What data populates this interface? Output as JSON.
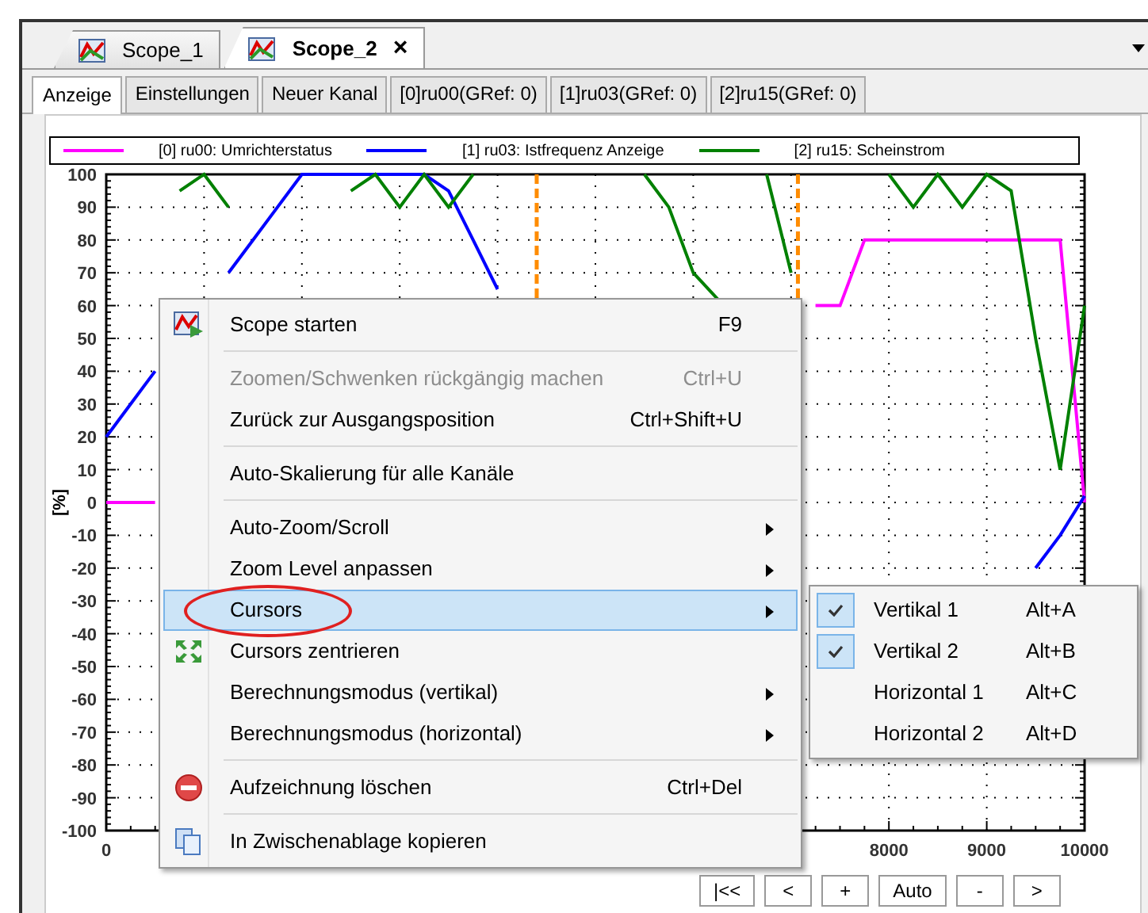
{
  "document_tabs": [
    {
      "label": "Scope_1",
      "selected": false,
      "closable": false
    },
    {
      "label": "Scope_2",
      "selected": true,
      "closable": true,
      "close": "×"
    }
  ],
  "view_tabs": [
    {
      "label": "Anzeige",
      "selected": true
    },
    {
      "label": "Einstellungen",
      "selected": false
    },
    {
      "label": "Neuer Kanal",
      "selected": false
    },
    {
      "label": "[0]ru00(GRef: 0)",
      "selected": false
    },
    {
      "label": "[1]ru03(GRef: 0)",
      "selected": false
    },
    {
      "label": "[2]ru15(GRef: 0)",
      "selected": false
    }
  ],
  "scope": {
    "chart_data": {
      "type": "line",
      "ylabel": "[%]",
      "x": [
        0,
        250,
        500,
        750,
        1000,
        1250,
        1500,
        1750,
        2000,
        2250,
        2500,
        2750,
        3000,
        3250,
        3500,
        3750,
        4000,
        4250,
        4500,
        4750,
        5000,
        5250,
        5500,
        5750,
        6000,
        6250,
        6500,
        6750,
        7000,
        7250,
        7500,
        7750,
        8000,
        8250,
        8500,
        8750,
        9000,
        9250,
        9500,
        9750,
        10000
      ],
      "xlim": [
        0,
        10000
      ],
      "ylim": [
        -100,
        100
      ],
      "xticks": [
        0,
        8000,
        9000,
        10000
      ],
      "grid": true,
      "yticks": [
        -100,
        -90,
        -80,
        -70,
        -60,
        -50,
        -40,
        -30,
        -20,
        -10,
        0,
        10,
        20,
        30,
        40,
        50,
        60,
        70,
        80,
        90,
        100
      ],
      "series": [
        {
          "name": "[0] ru00: Umrichterstatus",
          "color": "#ff00ff",
          "values": [
            0,
            0,
            0,
            null,
            null,
            null,
            null,
            null,
            null,
            null,
            null,
            null,
            null,
            null,
            null,
            null,
            null,
            null,
            null,
            null,
            null,
            null,
            null,
            null,
            null,
            null,
            null,
            null,
            null,
            60,
            60,
            80,
            80,
            80,
            80,
            80,
            80,
            80,
            80,
            80,
            0
          ]
        },
        {
          "name": "[1] ru03: Istfrequenz Anzeige",
          "color": "#0000ff",
          "values": [
            20,
            30,
            40,
            null,
            null,
            70,
            80,
            90,
            100,
            100,
            100,
            100,
            100,
            100,
            95,
            80,
            65,
            null,
            null,
            null,
            null,
            null,
            null,
            null,
            null,
            null,
            null,
            null,
            null,
            null,
            null,
            null,
            null,
            null,
            null,
            null,
            null,
            null,
            -20,
            -10,
            2
          ]
        },
        {
          "name": "[2] ru15: Scheinstrom",
          "color": "#008000",
          "values": [
            null,
            null,
            null,
            95,
            100,
            90,
            null,
            null,
            null,
            null,
            95,
            100,
            90,
            100,
            90,
            100,
            null,
            null,
            null,
            null,
            null,
            null,
            100,
            90,
            70,
            62,
            null,
            100,
            70,
            null,
            null,
            null,
            100,
            90,
            100,
            90,
            100,
            95,
            50,
            10,
            60
          ]
        }
      ],
      "ref_lines": [
        {
          "axis": "x",
          "value": 4400,
          "color": "#ff8c00"
        },
        {
          "axis": "x",
          "value": 7070,
          "color": "#ff8c00"
        }
      ]
    }
  },
  "nav_buttons": [
    "|<<",
    "<",
    "+",
    "Auto",
    "-",
    ">"
  ],
  "context_menu": [
    [
      {
        "label": "Scope starten",
        "shortcut": "F9",
        "disabled": false,
        "selected": false,
        "has_submenu": false
      }
    ],
    [
      {
        "label": "Zoomen/Schwenken rückgängig machen",
        "shortcut": "Ctrl+U",
        "disabled": true,
        "selected": false,
        "has_submenu": false
      },
      {
        "label": "Zurück zur Ausgangsposition",
        "shortcut": "Ctrl+Shift+U",
        "disabled": false,
        "selected": false,
        "has_submenu": false
      }
    ],
    [
      {
        "label": "Auto-Skalierung für alle Kanäle",
        "disabled": false,
        "selected": false,
        "has_submenu": false
      }
    ],
    [
      {
        "label": "Auto-Zoom/Scroll",
        "disabled": false,
        "selected": false,
        "has_submenu": true
      },
      {
        "label": "Zoom Level anpassen",
        "disabled": false,
        "selected": false,
        "has_submenu": true
      },
      {
        "label": "Cursors",
        "disabled": false,
        "selected": true,
        "has_submenu": true,
        "expanded": true,
        "submenu": [
          {
            "label": "Vertikal 1",
            "shortcut": "Alt+A",
            "checked": true
          },
          {
            "label": "Vertikal 2",
            "shortcut": "Alt+B",
            "checked": true
          },
          {
            "label": "Horizontal 1",
            "shortcut": "Alt+C",
            "checked": false
          },
          {
            "label": "Horizontal 2",
            "shortcut": "Alt+D",
            "checked": false
          }
        ]
      },
      {
        "label": "Cursors zentrieren",
        "disabled": false,
        "selected": false,
        "has_submenu": false
      },
      {
        "label": "Berechnungsmodus (vertikal)",
        "disabled": false,
        "selected": false,
        "has_submenu": true
      },
      {
        "label": "Berechnungsmodus (horizontal)",
        "disabled": false,
        "selected": false,
        "has_submenu": true
      }
    ],
    [
      {
        "label": "Aufzeichnung löschen",
        "shortcut": "Ctrl+Del",
        "disabled": false,
        "selected": false,
        "has_submenu": false
      }
    ],
    [
      {
        "label": "In Zwischenablage kopieren",
        "disabled": false,
        "selected": false,
        "has_submenu": false
      }
    ]
  ]
}
